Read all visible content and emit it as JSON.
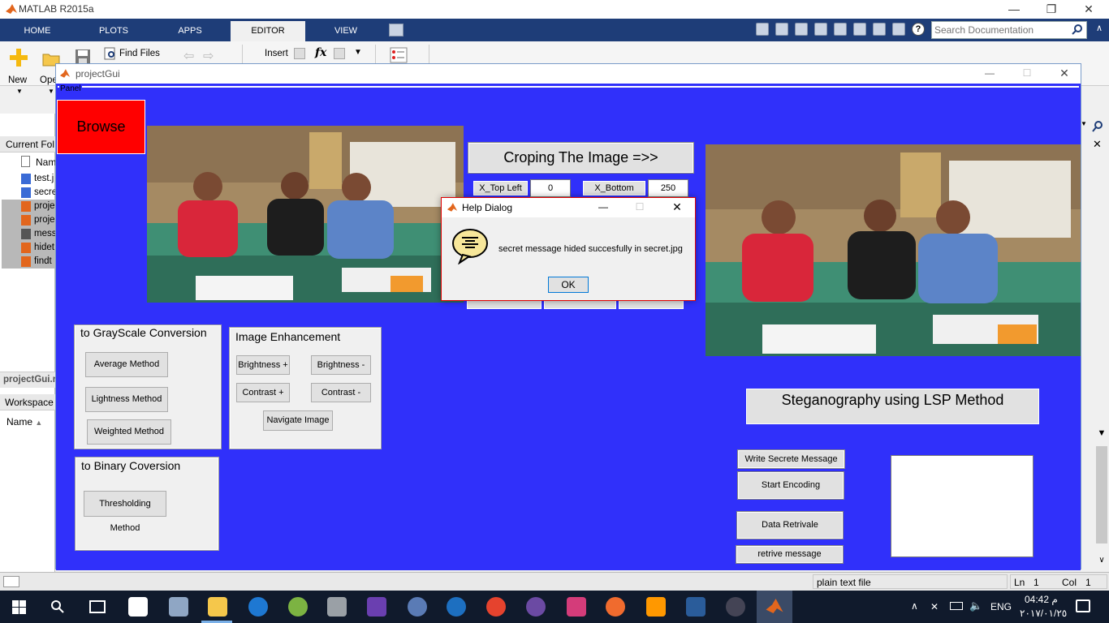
{
  "matlab": {
    "title": "MATLAB R2015a",
    "tabs": [
      "HOME",
      "PLOTS",
      "APPS",
      "EDITOR",
      "VIEW"
    ],
    "active_tab": "EDITOR",
    "search_placeholder": "Search Documentation",
    "toolstrip": {
      "new_label": "New",
      "open_label": "Ope",
      "find_files_label": "Find Files",
      "insert_label": "Insert",
      "fx_label": "fx"
    },
    "current_folder_label": "Current Fol",
    "name_header": "Nam",
    "files": [
      "test.j",
      "secre",
      "proje",
      "proje",
      "mess",
      "hidet",
      "findt"
    ],
    "project_label": "projectGui.r",
    "workspace_label": "Workspace",
    "workspace_name_header": "Name",
    "status": {
      "file_type": "plain text file",
      "ln_label": "Ln",
      "ln_value": "1",
      "col_label": "Col",
      "col_value": "1"
    }
  },
  "gui": {
    "title": "projectGui",
    "panel_label": "Panel",
    "browse_label": "Browse",
    "crop_button": "Croping The Image =>>",
    "x_top_left_label": "X_Top Left",
    "x_top_left_value": "0",
    "x_bottom_right_label": "X_Bottom Right",
    "x_bottom_right_value": "250",
    "grayscale": {
      "title": "to GrayScale Conversion",
      "average": "Average Method",
      "lightness": "Lightness Method",
      "weighted": "Weighted Method"
    },
    "enhancement": {
      "title": "Image Enhancement",
      "brightness_plus": "Brightness +",
      "brightness_minus": "Brightness -",
      "contrast_plus": "Contrast +",
      "contrast_minus": "Contrast -",
      "navigate": "Navigate Image"
    },
    "binary": {
      "title": "to Binary Coversion",
      "thresholding": "Thresholding Method"
    },
    "steg_title": "Steganography using LSP Method",
    "write_message": "Write Secrete Message",
    "start_encoding": "Start Encoding",
    "data_retrival": "Data Retrivale",
    "retrive_message": "retrive message",
    "browse_color": "#ff0000",
    "background_color": "#3030fa"
  },
  "dialog": {
    "title": "Help Dialog",
    "message": "secret message hided succesfully in secret.jpg",
    "ok": "OK"
  },
  "taskbar": {
    "time": "04:42 م",
    "date": "٢٠١٧/٠١/٢٥",
    "lang": "ENG"
  }
}
